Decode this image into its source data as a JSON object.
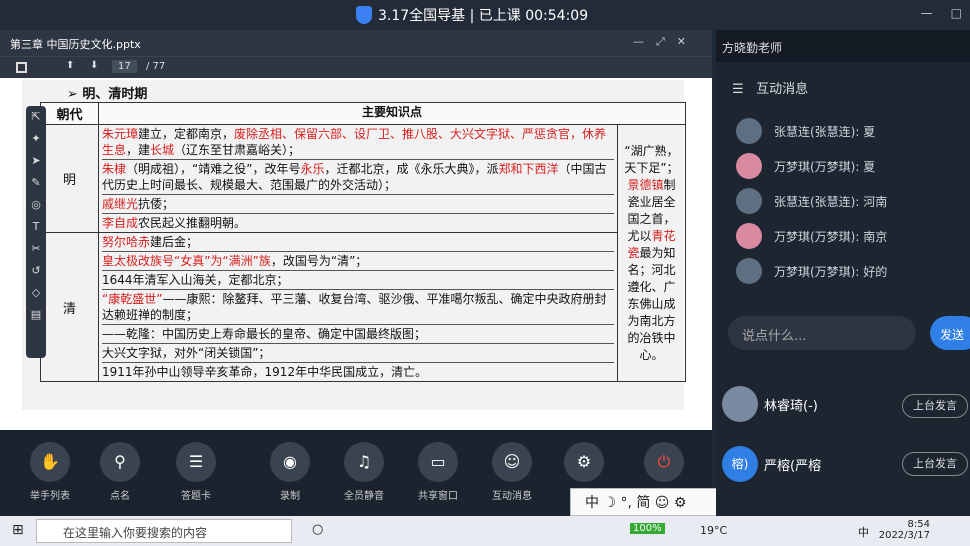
{
  "titlebar": {
    "text": "3.17全国导基 | 已上课 00:54:09"
  },
  "ppt": {
    "title": "第三章 中国历史文化.pptx",
    "page": "17",
    "total": "/ 77"
  },
  "slide": {
    "heading": "➢ 明、清时期",
    "col1": "朝代",
    "col2": "主要知识点",
    "ming": "明",
    "qing": "清",
    "ming_lines": [
      {
        "r": "朱元璋",
        "t": "建立，定都南京，",
        "r2": "废除丞相、保留六部、设厂卫、推八股、大兴文字狱、严惩贪官，休养生息",
        "t2": "，建",
        "r3": "长城",
        "t3": "（辽东至甘肃嘉峪关）；"
      },
      {
        "r": "朱棣",
        "t": "（明成祖），“靖难之役”，改年号",
        "r2": "永乐",
        "t2": "，迁都北京，成《永乐大典》，派",
        "r3": "郑和下西洋",
        "t3": "（中国古代历史上时间最长、规模最大、范围最广的外交活动）；"
      },
      {
        "r": "戚继光",
        "t": "抗倭；",
        "r2": "",
        "t2": "",
        "r3": "",
        "t3": ""
      },
      {
        "r": "李自成",
        "t": "农民起义推翻明朝。",
        "r2": "",
        "t2": "",
        "r3": "",
        "t3": ""
      }
    ],
    "qing_lines": [
      {
        "r": "努尔哈赤",
        "t": "建后金；"
      },
      {
        "r": "皇太极改族号“女真”为“满洲”族",
        "t": "，改国号为“清”；"
      },
      {
        "r": "",
        "t": "1644年清军入山海关，定都北京；"
      },
      {
        "r": "“康乾盛世”",
        "t": "——康熙：除鳌拜、平三藩、收复台湾、驱沙俄、平准噶尔叛乱、确定中央政府册封达赖班禅的制度；"
      },
      {
        "r": "",
        "t": "——乾隆：中国历史上寿命最长的皇帝、确定中国最终版图；"
      },
      {
        "r": "",
        "t": "大兴文字狱，对外“闭关锁国”；"
      },
      {
        "r": "",
        "t": "1911年孙中山领导辛亥革命，1912年中华民国成立，清亡。"
      }
    ],
    "side_pre": "“湖广熟，天下足”；",
    "side_r": "景德镇",
    "side_mid": "制瓷业居全国之首，尤以",
    "side_r2": "青花瓷",
    "side_post": "最为知名；河北遵化、广东佛山成为南北方的冶铁中心。"
  },
  "bottom": [
    "举手列表",
    "点名",
    "答题卡",
    "录制",
    "全员静音",
    "共享窗口",
    "互动消息",
    "设置",
    "下课"
  ],
  "ime": "中 ☽ °, 简 ☺ ⚙",
  "right": {
    "teacher": "方晓勤老师",
    "msgs_title": "互动消息",
    "messages": [
      "张慧连(张慧连): 夏",
      "万梦琪(万梦琪): 夏",
      "张慧连(张慧连): 河南",
      "万梦琪(万梦琪): 南京",
      "万梦琪(万梦琪): 好的"
    ],
    "input_placeholder": "说点什么...",
    "send": "发送",
    "seats": [
      {
        "name": "林睿琦(-)",
        "btn": "上台发言"
      },
      {
        "name": "严榕(严榕",
        "btn": "上台发言",
        "av": "榕)"
      }
    ]
  },
  "taskbar": {
    "search": "在这里输入你要搜索的内容",
    "battery": "100%",
    "temp": "19°C",
    "lang": "中",
    "time": "8:54",
    "date": "2022/3/17"
  }
}
